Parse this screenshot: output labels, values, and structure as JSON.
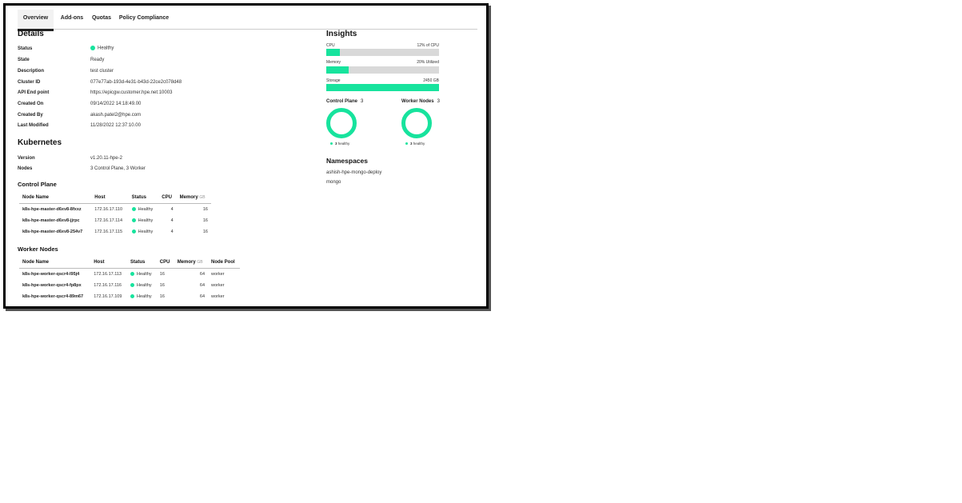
{
  "tabs": [
    "Overview",
    "Add-ons",
    "Quotas",
    "Policy Compliance"
  ],
  "details": {
    "heading": "Details",
    "rows": [
      {
        "label": "Status",
        "value": "Healthy"
      },
      {
        "label": "State",
        "value": "Ready"
      },
      {
        "label": "Description",
        "value": "test cluster"
      },
      {
        "label": "Cluster ID",
        "value": "077e77ab-193d-4e31-b43d-22ce2c078d48"
      },
      {
        "label": "API End point",
        "value": "https://epicgw.customer.hpe.net:10003"
      },
      {
        "label": "Created On",
        "value": "09/14/2022 14:18:49.00"
      },
      {
        "label": "Created By",
        "value": "akash.patel2@hpe.com"
      },
      {
        "label": "Last Modified",
        "value": "11/28/2022 12:37:10.00"
      }
    ]
  },
  "kubernetes": {
    "heading": "Kubernetes",
    "rows": [
      {
        "label": "Version",
        "value": "v1.20.11-hpe-2"
      },
      {
        "label": "Nodes",
        "value": "3 Control Plane, 3 Worker"
      }
    ]
  },
  "control_plane": {
    "heading": "Control Plane",
    "columns": {
      "node": "Node Name",
      "host": "Host",
      "status": "Status",
      "cpu": "CPU",
      "memory": "Memory",
      "unit": "GB"
    },
    "rows": [
      {
        "node": "k8s-hpe-master-d6xv8-8fxxz",
        "host": "172.16.17.110",
        "status": "Healthy",
        "cpu": "4",
        "memory": "16"
      },
      {
        "node": "k8s-hpe-master-d6xv8-jjrpc",
        "host": "172.16.17.114",
        "status": "Healthy",
        "cpu": "4",
        "memory": "16"
      },
      {
        "node": "k8s-hpe-master-d6xv8-254v7",
        "host": "172.16.17.115",
        "status": "Healthy",
        "cpu": "4",
        "memory": "16"
      }
    ]
  },
  "worker_nodes": {
    "heading": "Worker Nodes",
    "columns": {
      "node": "Node Name",
      "host": "Host",
      "status": "Status",
      "cpu": "CPU",
      "memory": "Memory",
      "unit": "GB",
      "pool": "Node Pool"
    },
    "rows": [
      {
        "node": "k8s-hpe-worker-qscr4-l95j4",
        "host": "172.16.17.113",
        "status": "Healthy",
        "cpu": "16",
        "memory": "64",
        "pool": "worker"
      },
      {
        "node": "k8s-hpe-worker-qscr4-fp8px",
        "host": "172.16.17.116",
        "status": "Healthy",
        "cpu": "16",
        "memory": "64",
        "pool": "worker"
      },
      {
        "node": "k8s-hpe-worker-qscr4-89m67",
        "host": "172.16.17.109",
        "status": "Healthy",
        "cpu": "16",
        "memory": "64",
        "pool": "worker"
      }
    ]
  },
  "insights": {
    "heading": "Insights",
    "cpu": {
      "label": "CPU",
      "value": "12% of CPU",
      "fraction": 0.12
    },
    "memory": {
      "label": "Memory",
      "value": "20% Utilized",
      "fraction": 0.2
    },
    "storage": {
      "label": "Storage",
      "value": "2450 GB",
      "fraction": 1.0
    },
    "control_plane": {
      "label": "Control Plane",
      "count": "3",
      "healthy_count": "3",
      "healthy_label": "healthy"
    },
    "worker_nodes": {
      "label": "Worker Nodes",
      "count": "3",
      "healthy_count": "3",
      "healthy_label": "healthy"
    }
  },
  "namespaces": {
    "heading": "Namespaces",
    "items": [
      "ashish-hpe-mongo-deploy",
      "mongo"
    ]
  },
  "colors": {
    "healthy": "#17e39d",
    "bar_bg": "#d9d9d9"
  }
}
